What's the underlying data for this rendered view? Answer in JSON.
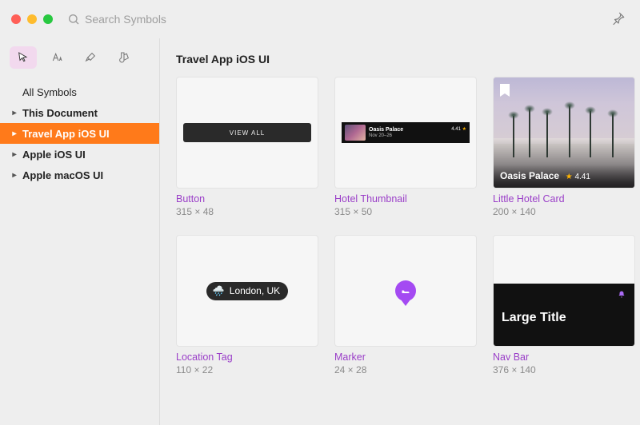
{
  "search": {
    "placeholder": "Search Symbols"
  },
  "sidebar": {
    "items": [
      {
        "label": "All Symbols",
        "chevron": false,
        "bold": false,
        "selected": false
      },
      {
        "label": "This Document",
        "chevron": true,
        "bold": true,
        "selected": false
      },
      {
        "label": "Travel App iOS UI",
        "chevron": true,
        "bold": true,
        "selected": true
      },
      {
        "label": "Apple iOS UI",
        "chevron": true,
        "bold": true,
        "selected": false
      },
      {
        "label": "Apple macOS UI",
        "chevron": true,
        "bold": true,
        "selected": false
      }
    ]
  },
  "main": {
    "title": "Travel App iOS UI",
    "symbols": [
      {
        "name": "Button",
        "dim": "315 × 48",
        "preview": {
          "kind": "button",
          "label": "VIEW ALL"
        }
      },
      {
        "name": "Hotel Thumbnail",
        "dim": "315 × 50",
        "preview": {
          "kind": "hotel_thumb",
          "title": "Oasis Palace",
          "sub": "Nov 20–26",
          "rating": "4.41"
        }
      },
      {
        "name": "Little Hotel Card",
        "dim": "200 × 140",
        "preview": {
          "kind": "hotel_card",
          "title": "Oasis Palace",
          "rating": "4.41"
        }
      },
      {
        "name": "Location Tag",
        "dim": "110 × 22",
        "preview": {
          "kind": "location_tag",
          "label": "London, UK"
        }
      },
      {
        "name": "Marker",
        "dim": "24 × 28",
        "preview": {
          "kind": "marker"
        }
      },
      {
        "name": "Nav Bar",
        "dim": "376 × 140",
        "preview": {
          "kind": "navbar",
          "title": "Large Title"
        }
      }
    ]
  }
}
